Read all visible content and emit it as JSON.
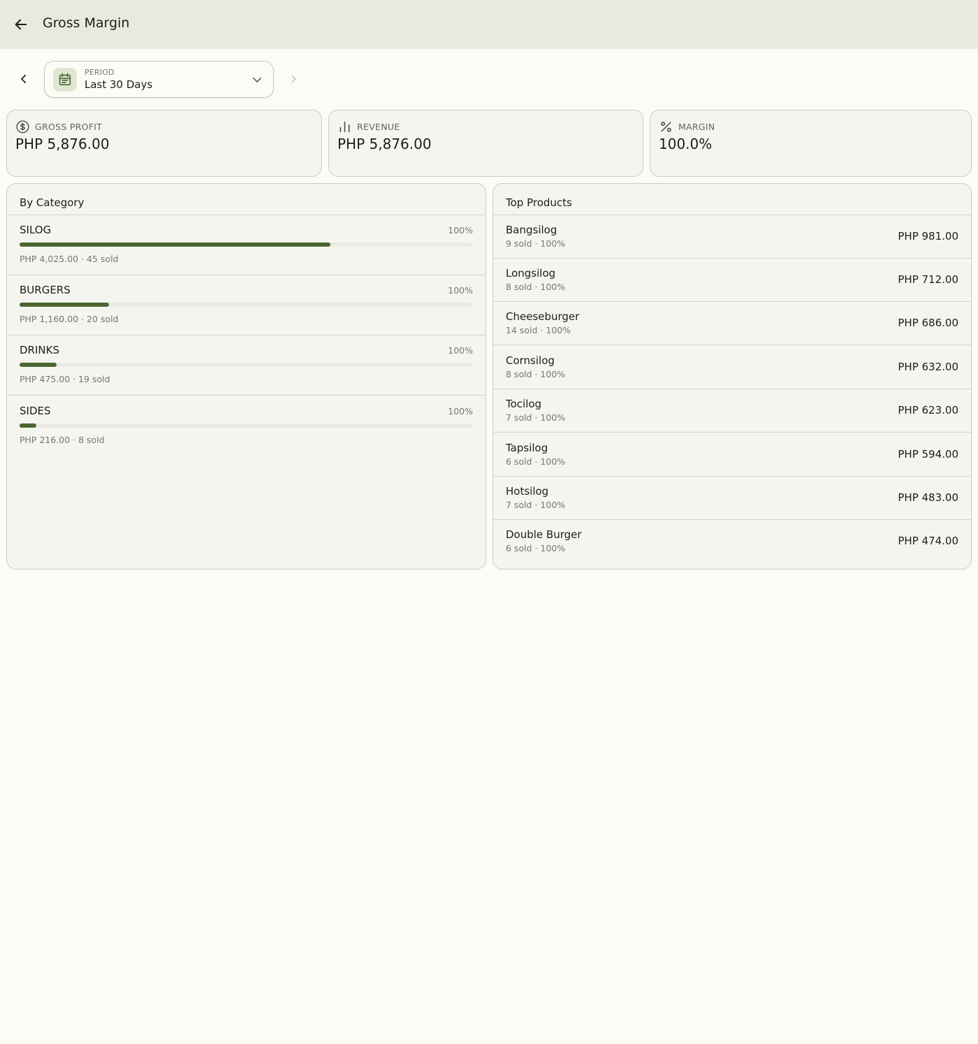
{
  "header": {
    "title": "Gross Margin"
  },
  "period": {
    "label": "PERIOD",
    "value": "Last 30 Days"
  },
  "stats": [
    {
      "label": "GROSS PROFIT",
      "value": "PHP 5,876.00",
      "icon": "dollar-circle-icon"
    },
    {
      "label": "REVENUE",
      "value": "PHP 5,876.00",
      "icon": "bar-chart-icon"
    },
    {
      "label": "MARGIN",
      "value": "100.0%",
      "icon": "percent-icon"
    }
  ],
  "by_category": {
    "title": "By Category",
    "accent_color": "#4a6630",
    "items": [
      {
        "name": "SILOG",
        "pct": "100%",
        "meta": "PHP 4,025.00 · 45 sold",
        "share": 0.685
      },
      {
        "name": "BURGERS",
        "pct": "100%",
        "meta": "PHP 1,160.00 · 20 sold",
        "share": 0.197
      },
      {
        "name": "DRINKS",
        "pct": "100%",
        "meta": "PHP 475.00 · 19 sold",
        "share": 0.081
      },
      {
        "name": "SIDES",
        "pct": "100%",
        "meta": "PHP 216.00 · 8 sold",
        "share": 0.037
      }
    ]
  },
  "top_products": {
    "title": "Top Products",
    "items": [
      {
        "name": "Bangsilog",
        "meta": "9 sold · 100%",
        "amount": "PHP 981.00"
      },
      {
        "name": "Longsilog",
        "meta": "8 sold · 100%",
        "amount": "PHP 712.00"
      },
      {
        "name": "Cheeseburger",
        "meta": "14 sold · 100%",
        "amount": "PHP 686.00"
      },
      {
        "name": "Cornsilog",
        "meta": "8 sold · 100%",
        "amount": "PHP 632.00"
      },
      {
        "name": "Tocilog",
        "meta": "7 sold · 100%",
        "amount": "PHP 623.00"
      },
      {
        "name": "Tapsilog",
        "meta": "6 sold · 100%",
        "amount": "PHP 594.00"
      },
      {
        "name": "Hotsilog",
        "meta": "7 sold · 100%",
        "amount": "PHP 483.00"
      },
      {
        "name": "Double Burger",
        "meta": "6 sold · 100%",
        "amount": "PHP 474.00"
      }
    ]
  }
}
